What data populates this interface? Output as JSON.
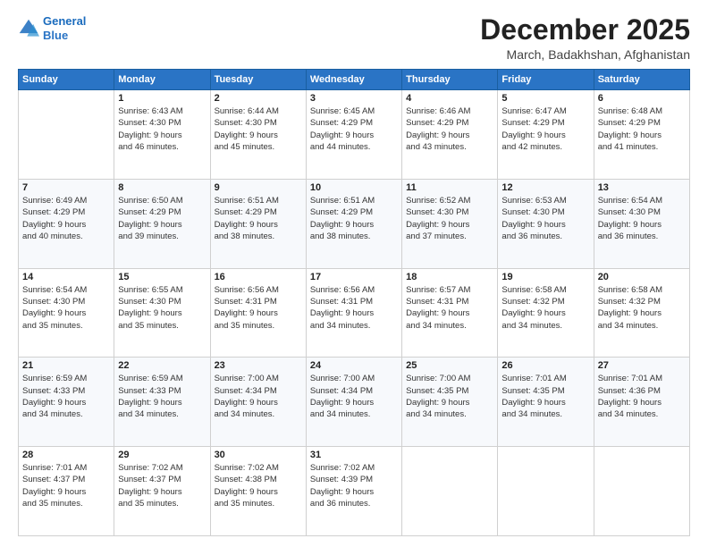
{
  "header": {
    "logo_line1": "General",
    "logo_line2": "Blue",
    "main_title": "December 2025",
    "sub_title": "March, Badakhshan, Afghanistan"
  },
  "days_of_week": [
    "Sunday",
    "Monday",
    "Tuesday",
    "Wednesday",
    "Thursday",
    "Friday",
    "Saturday"
  ],
  "weeks": [
    [
      {
        "day": "",
        "info": ""
      },
      {
        "day": "1",
        "info": "Sunrise: 6:43 AM\nSunset: 4:30 PM\nDaylight: 9 hours\nand 46 minutes."
      },
      {
        "day": "2",
        "info": "Sunrise: 6:44 AM\nSunset: 4:30 PM\nDaylight: 9 hours\nand 45 minutes."
      },
      {
        "day": "3",
        "info": "Sunrise: 6:45 AM\nSunset: 4:29 PM\nDaylight: 9 hours\nand 44 minutes."
      },
      {
        "day": "4",
        "info": "Sunrise: 6:46 AM\nSunset: 4:29 PM\nDaylight: 9 hours\nand 43 minutes."
      },
      {
        "day": "5",
        "info": "Sunrise: 6:47 AM\nSunset: 4:29 PM\nDaylight: 9 hours\nand 42 minutes."
      },
      {
        "day": "6",
        "info": "Sunrise: 6:48 AM\nSunset: 4:29 PM\nDaylight: 9 hours\nand 41 minutes."
      }
    ],
    [
      {
        "day": "7",
        "info": "Sunrise: 6:49 AM\nSunset: 4:29 PM\nDaylight: 9 hours\nand 40 minutes."
      },
      {
        "day": "8",
        "info": "Sunrise: 6:50 AM\nSunset: 4:29 PM\nDaylight: 9 hours\nand 39 minutes."
      },
      {
        "day": "9",
        "info": "Sunrise: 6:51 AM\nSunset: 4:29 PM\nDaylight: 9 hours\nand 38 minutes."
      },
      {
        "day": "10",
        "info": "Sunrise: 6:51 AM\nSunset: 4:29 PM\nDaylight: 9 hours\nand 38 minutes."
      },
      {
        "day": "11",
        "info": "Sunrise: 6:52 AM\nSunset: 4:30 PM\nDaylight: 9 hours\nand 37 minutes."
      },
      {
        "day": "12",
        "info": "Sunrise: 6:53 AM\nSunset: 4:30 PM\nDaylight: 9 hours\nand 36 minutes."
      },
      {
        "day": "13",
        "info": "Sunrise: 6:54 AM\nSunset: 4:30 PM\nDaylight: 9 hours\nand 36 minutes."
      }
    ],
    [
      {
        "day": "14",
        "info": "Sunrise: 6:54 AM\nSunset: 4:30 PM\nDaylight: 9 hours\nand 35 minutes."
      },
      {
        "day": "15",
        "info": "Sunrise: 6:55 AM\nSunset: 4:30 PM\nDaylight: 9 hours\nand 35 minutes."
      },
      {
        "day": "16",
        "info": "Sunrise: 6:56 AM\nSunset: 4:31 PM\nDaylight: 9 hours\nand 35 minutes."
      },
      {
        "day": "17",
        "info": "Sunrise: 6:56 AM\nSunset: 4:31 PM\nDaylight: 9 hours\nand 34 minutes."
      },
      {
        "day": "18",
        "info": "Sunrise: 6:57 AM\nSunset: 4:31 PM\nDaylight: 9 hours\nand 34 minutes."
      },
      {
        "day": "19",
        "info": "Sunrise: 6:58 AM\nSunset: 4:32 PM\nDaylight: 9 hours\nand 34 minutes."
      },
      {
        "day": "20",
        "info": "Sunrise: 6:58 AM\nSunset: 4:32 PM\nDaylight: 9 hours\nand 34 minutes."
      }
    ],
    [
      {
        "day": "21",
        "info": "Sunrise: 6:59 AM\nSunset: 4:33 PM\nDaylight: 9 hours\nand 34 minutes."
      },
      {
        "day": "22",
        "info": "Sunrise: 6:59 AM\nSunset: 4:33 PM\nDaylight: 9 hours\nand 34 minutes."
      },
      {
        "day": "23",
        "info": "Sunrise: 7:00 AM\nSunset: 4:34 PM\nDaylight: 9 hours\nand 34 minutes."
      },
      {
        "day": "24",
        "info": "Sunrise: 7:00 AM\nSunset: 4:34 PM\nDaylight: 9 hours\nand 34 minutes."
      },
      {
        "day": "25",
        "info": "Sunrise: 7:00 AM\nSunset: 4:35 PM\nDaylight: 9 hours\nand 34 minutes."
      },
      {
        "day": "26",
        "info": "Sunrise: 7:01 AM\nSunset: 4:35 PM\nDaylight: 9 hours\nand 34 minutes."
      },
      {
        "day": "27",
        "info": "Sunrise: 7:01 AM\nSunset: 4:36 PM\nDaylight: 9 hours\nand 34 minutes."
      }
    ],
    [
      {
        "day": "28",
        "info": "Sunrise: 7:01 AM\nSunset: 4:37 PM\nDaylight: 9 hours\nand 35 minutes."
      },
      {
        "day": "29",
        "info": "Sunrise: 7:02 AM\nSunset: 4:37 PM\nDaylight: 9 hours\nand 35 minutes."
      },
      {
        "day": "30",
        "info": "Sunrise: 7:02 AM\nSunset: 4:38 PM\nDaylight: 9 hours\nand 35 minutes."
      },
      {
        "day": "31",
        "info": "Sunrise: 7:02 AM\nSunset: 4:39 PM\nDaylight: 9 hours\nand 36 minutes."
      },
      {
        "day": "",
        "info": ""
      },
      {
        "day": "",
        "info": ""
      },
      {
        "day": "",
        "info": ""
      }
    ]
  ]
}
